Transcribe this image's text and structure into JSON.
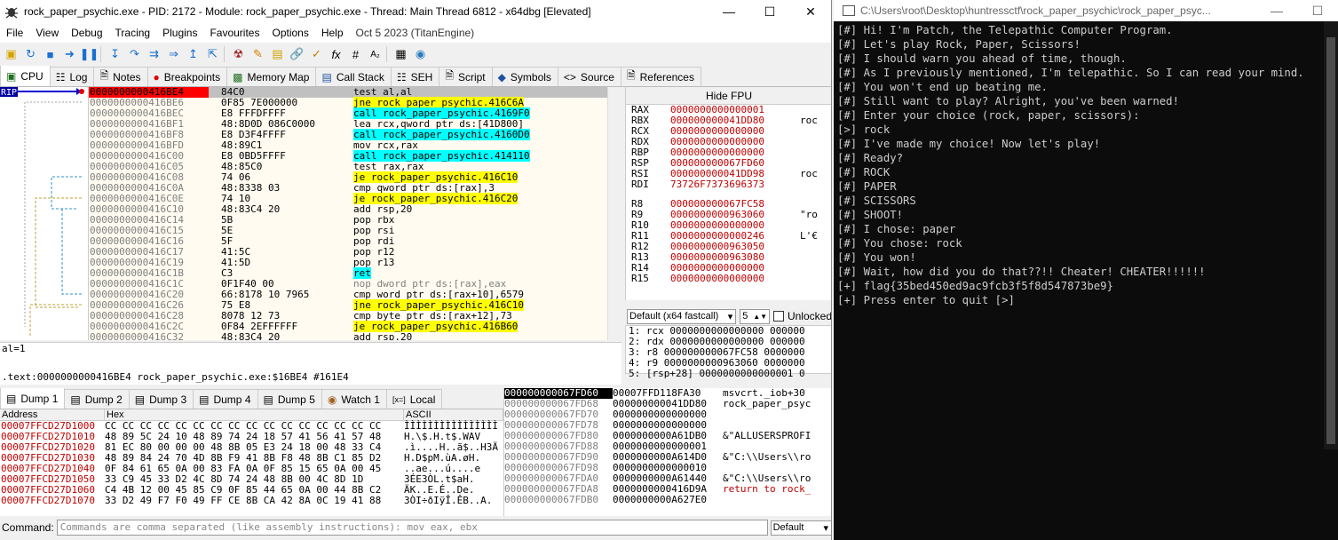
{
  "xdbg": {
    "title": "rock_paper_psychic.exe - PID: 2172 - Module: rock_paper_psychic.exe - Thread: Main Thread 6812 - x64dbg [Elevated]",
    "menu": [
      "File",
      "View",
      "Debug",
      "Tracing",
      "Plugins",
      "Favourites",
      "Options",
      "Help"
    ],
    "menu_date": "Oct 5 2023 (TitanEngine)",
    "cpu_tabs": [
      {
        "label": "CPU",
        "icon": "cpu-icon"
      },
      {
        "label": "Log",
        "icon": "log-icon"
      },
      {
        "label": "Notes",
        "icon": "notes-icon"
      },
      {
        "label": "Breakpoints",
        "icon": "breakpoint-icon"
      },
      {
        "label": "Memory Map",
        "icon": "memory-map-icon"
      },
      {
        "label": "Call Stack",
        "icon": "call-stack-icon"
      },
      {
        "label": "SEH",
        "icon": "seh-icon"
      },
      {
        "label": "Script",
        "icon": "script-icon"
      },
      {
        "label": "Symbols",
        "icon": "symbols-icon"
      },
      {
        "label": "Source",
        "icon": "source-icon"
      },
      {
        "label": "References",
        "icon": "references-icon"
      }
    ],
    "rip_label": "RIP",
    "disasm": [
      {
        "addr": "0000000000416BE4",
        "bytes": "84C0",
        "ins": "test al,al",
        "hl": "",
        "cur": true
      },
      {
        "addr": "0000000000416BE6",
        "bytes": "0F85 7E000000",
        "ins": "jne rock_paper_psychic.416C6A",
        "hl": "y"
      },
      {
        "addr": "0000000000416BEC",
        "bytes": "E8 FFFDFFFF",
        "ins": "call rock_paper_psychic.4169F0",
        "hl": "c"
      },
      {
        "addr": "0000000000416BF1",
        "bytes": "48:8D0D 086C0000",
        "ins": "lea rcx,qword ptr ds:[41D800]",
        "hl": ""
      },
      {
        "addr": "0000000000416BF8",
        "bytes": "E8 D3F4FFFF",
        "ins": "call rock_paper_psychic.4160D0",
        "hl": "c"
      },
      {
        "addr": "0000000000416BFD",
        "bytes": "48:89C1",
        "ins": "mov rcx,rax",
        "hl": ""
      },
      {
        "addr": "0000000000416C00",
        "bytes": "E8 0BD5FFFF",
        "ins": "call rock_paper_psychic.414110",
        "hl": "c"
      },
      {
        "addr": "0000000000416C05",
        "bytes": "48:85C0",
        "ins": "test rax,rax",
        "hl": ""
      },
      {
        "addr": "0000000000416C08",
        "bytes": "74 06",
        "ins": "je rock_paper_psychic.416C10",
        "hl": "y"
      },
      {
        "addr": "0000000000416C0A",
        "bytes": "48:8338 03",
        "ins": "cmp qword ptr ds:[rax],3",
        "hl": ""
      },
      {
        "addr": "0000000000416C0E",
        "bytes": "74 10",
        "ins": "je rock_paper_psychic.416C20",
        "hl": "y"
      },
      {
        "addr": "0000000000416C10",
        "bytes": "48:83C4 20",
        "ins": "add rsp,20",
        "hl": ""
      },
      {
        "addr": "0000000000416C14",
        "bytes": "5B",
        "ins": "pop rbx",
        "hl": ""
      },
      {
        "addr": "0000000000416C15",
        "bytes": "5E",
        "ins": "pop rsi",
        "hl": ""
      },
      {
        "addr": "0000000000416C16",
        "bytes": "5F",
        "ins": "pop rdi",
        "hl": ""
      },
      {
        "addr": "0000000000416C17",
        "bytes": "41:5C",
        "ins": "pop r12",
        "hl": ""
      },
      {
        "addr": "0000000000416C19",
        "bytes": "41:5D",
        "ins": "pop r13",
        "hl": ""
      },
      {
        "addr": "0000000000416C1B",
        "bytes": "C3",
        "ins": "ret",
        "hl": "c"
      },
      {
        "addr": "0000000000416C1C",
        "bytes": "0F1F40 00",
        "ins": "nop dword ptr ds:[rax],eax",
        "hl": "g"
      },
      {
        "addr": "0000000000416C20",
        "bytes": "66:8178 10 7965",
        "ins": "cmp word ptr ds:[rax+10],6579",
        "hl": ""
      },
      {
        "addr": "0000000000416C26",
        "bytes": "75 E8",
        "ins": "jne rock_paper_psychic.416C10",
        "hl": "y"
      },
      {
        "addr": "0000000000416C28",
        "bytes": "8078 12 73",
        "ins": "cmp byte ptr ds:[rax+12],73",
        "hl": ""
      },
      {
        "addr": "0000000000416C2C",
        "bytes": "0F84 2EFFFFFF",
        "ins": "je rock_paper_psychic.416B60",
        "hl": "y"
      },
      {
        "addr": "0000000000416C32",
        "bytes": "48:83C4 20",
        "ins": "add rsp,20",
        "hl": ""
      }
    ],
    "fpu_label": "Hide FPU",
    "registers": [
      {
        "n": "RAX",
        "v": "0000000000000001",
        "c": ""
      },
      {
        "n": "RBX",
        "v": "000000000041DD80",
        "c": "roc"
      },
      {
        "n": "RCX",
        "v": "0000000000000000",
        "c": ""
      },
      {
        "n": "RDX",
        "v": "0000000000000000",
        "c": ""
      },
      {
        "n": "RBP",
        "v": "0000000000000000",
        "c": ""
      },
      {
        "n": "RSP",
        "v": "000000000067FD60",
        "c": ""
      },
      {
        "n": "RSI",
        "v": "000000000041DD98",
        "c": "roc"
      },
      {
        "n": "RDI",
        "v": "73726F7373696373",
        "c": ""
      },
      {
        "n": "",
        "v": "",
        "c": ""
      },
      {
        "n": "R8",
        "v": "000000000067FC58",
        "c": ""
      },
      {
        "n": "R9",
        "v": "0000000000963060",
        "c": "\"ro"
      },
      {
        "n": "R10",
        "v": "0000000000000000",
        "c": ""
      },
      {
        "n": "R11",
        "v": "0000000000000246",
        "c": "L'€"
      },
      {
        "n": "R12",
        "v": "0000000000963050",
        "c": ""
      },
      {
        "n": "R13",
        "v": "0000000000963080",
        "c": ""
      },
      {
        "n": "R14",
        "v": "0000000000000000",
        "c": ""
      },
      {
        "n": "R15",
        "v": "0000000000000000",
        "c": ""
      }
    ],
    "callconv": "Default (x64 fastcall)",
    "argcount": "5",
    "unlocked_label": "Unlocked",
    "stack_args": [
      "1: rcx 0000000000000000 000000",
      "2: rdx 0000000000000000 000000",
      "3: r8 000000000067FC58 0000000",
      "4: r9 0000000000963060 0000000",
      "5: [rsp+28] 0000000000000001 0"
    ],
    "info_line1": "al=1",
    "info_line2": ".text:0000000000416BE4 rock_paper_psychic.exe:$16BE4 #161E4",
    "dump_tabs": [
      "Dump 1",
      "Dump 2",
      "Dump 3",
      "Dump 4",
      "Dump 5",
      "Watch 1",
      "Local"
    ],
    "dump_headers": [
      "Address",
      "Hex",
      "ASCII"
    ],
    "dump_rows": [
      {
        "a": "00007FFCD27D1000",
        "h": "CC CC CC CC CC CC CC CC CC CC CC CC CC CC CC CC",
        "s": "ÌÌÌÌÌÌÌÌÌÌÌÌÌÌÌÌ"
      },
      {
        "a": "00007FFCD27D1010",
        "h": "48 89 5C 24 10 48 89 74 24 18 57 41 56 41 57 48",
        "s": "H.\\$.H.t$.WAV"
      },
      {
        "a": "00007FFCD27D1020",
        "h": "81 EC 80 00 00 00 48 8B 05 E3 24 18 00 48 33 C4",
        "s": ".ì....H..ã$..H3Ä"
      },
      {
        "a": "00007FFCD27D1030",
        "h": "48 89 84 24 70 4D 8B F9 41 8B F8 48 8B C1 85 D2",
        "s": "H.D$pM.ùA.øH."
      },
      {
        "a": "00007FFCD27D1040",
        "h": "0F 84 61 65 0A 00 83 FA 0A 0F 85 15 65 0A 00 45",
        "s": "..ae...ú....e"
      },
      {
        "a": "00007FFCD27D1050",
        "h": "33 C9 45 33 D2 4C 8D 74 24 48 8B 00 4C 8D 1D",
        "s": "3ÉE3ÒL.t$aH."
      },
      {
        "a": "00007FFCD27D1060",
        "h": "C4 4B 12 00 45 85 C9 0F 85 44 65 0A 00 44 8B C2",
        "s": "ÄK..E.É..De."
      },
      {
        "a": "00007FFCD27D1070",
        "h": "33 D2 49 F7 F0 49 FF CE 8B CA 42 8A 0C 19 41 88",
        "s": "3ÒI÷ðIÿÎ.ÊB..A."
      }
    ],
    "stack": [
      {
        "a": "000000000067FD60",
        "v": "00007FFD118FA30",
        "c": "msvcrt._iob+30",
        "t": "top"
      },
      {
        "a": "000000000067FD68",
        "v": "000000000041DD80",
        "c": "rock_paper_psyc",
        "t": ""
      },
      {
        "a": "000000000067FD70",
        "v": "0000000000000000",
        "c": "",
        "t": ""
      },
      {
        "a": "000000000067FD78",
        "v": "0000000000000000",
        "c": "",
        "t": ""
      },
      {
        "a": "000000000067FD80",
        "v": "0000000000A61DB0",
        "c": "&\"ALLUSERSPROFI",
        "t": ""
      },
      {
        "a": "000000000067FD88",
        "v": "0000000000000001",
        "c": "",
        "t": ""
      },
      {
        "a": "000000000067FD90",
        "v": "0000000000A614D0",
        "c": "&\"C:\\\\Users\\\\ro",
        "t": ""
      },
      {
        "a": "000000000067FD98",
        "v": "0000000000000010",
        "c": "",
        "t": ""
      },
      {
        "a": "000000000067FDA0",
        "v": "0000000000A61440",
        "c": "&\"C:\\\\Users\\\\ro",
        "t": ""
      },
      {
        "a": "000000000067FDA8",
        "v": "0000000000416D9A",
        "c": "return to rock_",
        "t": "ret"
      },
      {
        "a": "000000000067FDB0",
        "v": "0000000000A627E0",
        "c": "",
        "t": ""
      }
    ],
    "command_label": "Command:",
    "command_placeholder": "Commands are comma separated (like assembly instructions): mov eax, ebx",
    "command_mode": "Default"
  },
  "console": {
    "title": "C:\\Users\\root\\Desktop\\huntressctf\\rock_paper_psychic\\rock_paper_psyc...",
    "lines": [
      "[#] Hi! I'm Patch, the Telepathic Computer Program.",
      "[#] Let's play Rock, Paper, Scissors!",
      "[#] I should warn you ahead of time, though.",
      "[#] As I previously mentioned, I'm telepathic. So I can read your mind.",
      "[#] You won't end up beating me.",
      "[#] Still want to play? Alright, you've been warned!",
      "[#] Enter your choice (rock, paper, scissors):",
      "[>] rock",
      "[#] I've made my choice! Now let's play!",
      "[#] Ready?",
      "[#] ROCK",
      "[#] PAPER",
      "[#] SCISSORS",
      "[#] SHOOT!",
      "[#] I chose: paper",
      "[#] You chose: rock",
      "[#] You won!",
      "[#] Wait, how did you do that??!! Cheater! CHEATER!!!!!!",
      "[+] flag{35bed450ed9ac9fcb3f5f8d547873be9}",
      "[+] Press enter to quit [>]"
    ]
  },
  "colors": {
    "console_bg": "#0c0c0c",
    "console_fg": "#cccccc",
    "rip": "#ff0000",
    "jump_hl": "#ffff00",
    "call_hl": "#00ffff"
  }
}
